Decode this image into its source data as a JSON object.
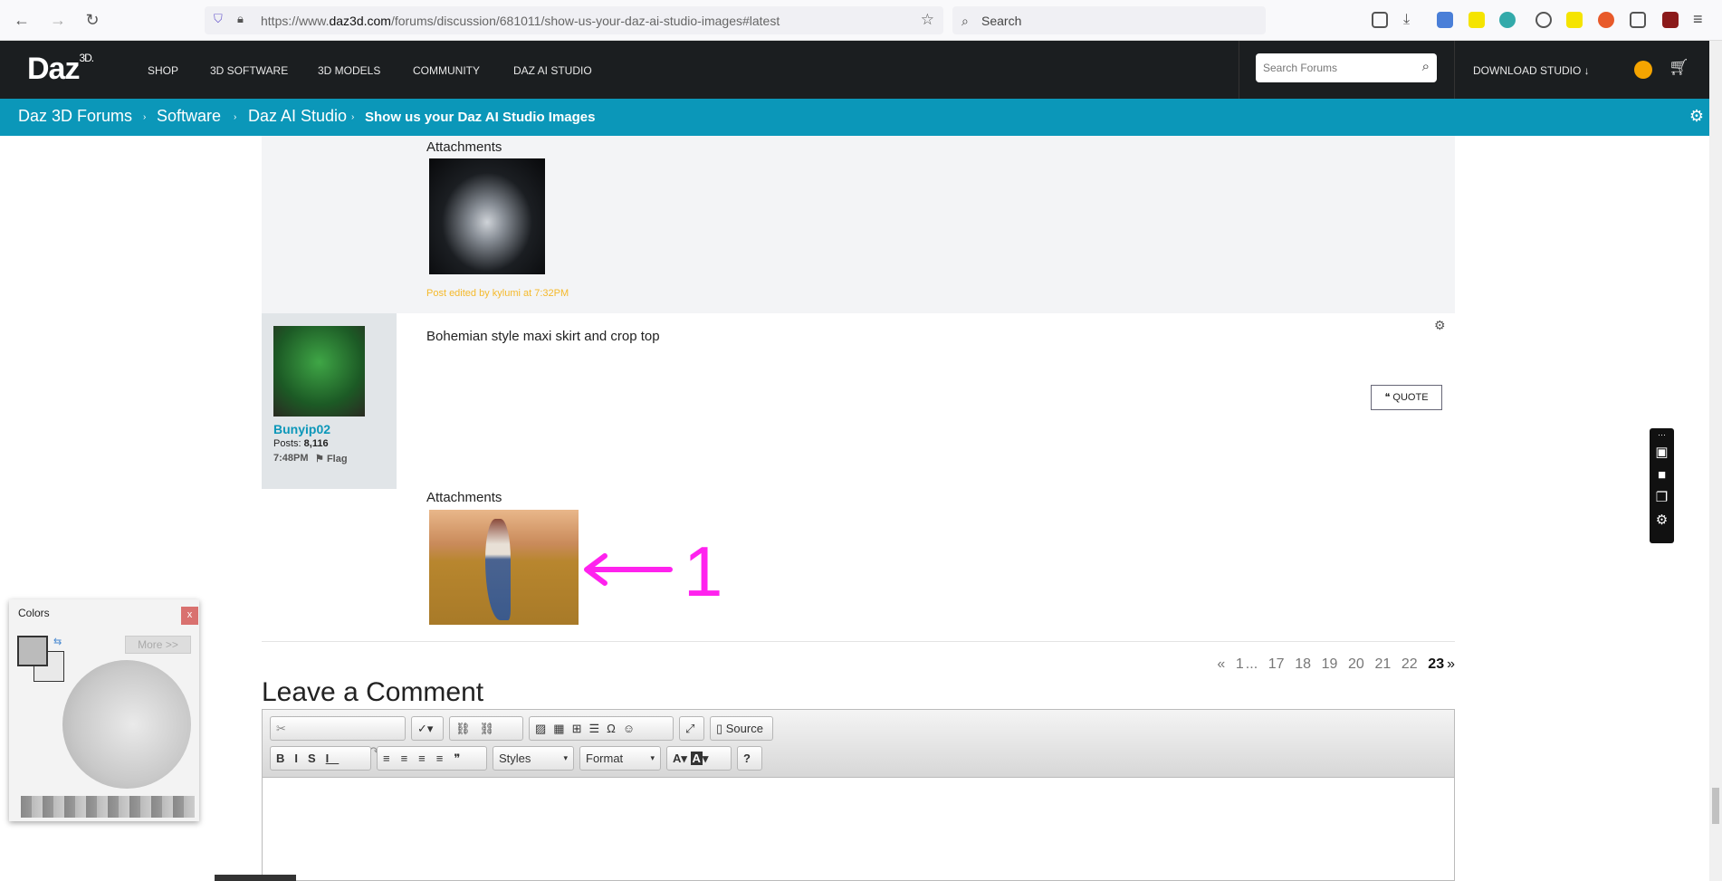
{
  "browser": {
    "url_prefix": "https://www.",
    "url_domain": "daz3d.com",
    "url_path": "/forums/discussion/681011/show-us-your-daz-ai-studio-images#latest",
    "search_placeholder": "Search"
  },
  "nav": {
    "logo": "Daz",
    "logo_sup": "3D.",
    "items": [
      "SHOP",
      "3D SOFTWARE",
      "3D MODELS",
      "COMMUNITY",
      "DAZ AI STUDIO"
    ],
    "search_placeholder": "Search Forums",
    "download": "DOWNLOAD STUDIO"
  },
  "breadcrumb": {
    "items": [
      "Daz 3D Forums",
      "Software",
      "Daz AI Studio"
    ],
    "current": "Show us your Daz AI Studio Images"
  },
  "post1": {
    "attachments_label": "Attachments",
    "edited": "Post edited by kylumi at 7:32PM"
  },
  "post2": {
    "username": "Bunyip02",
    "posts_label": "Posts:",
    "posts": "8,116",
    "time": "7:48PM",
    "flag": "Flag",
    "body": "Bohemian style maxi skirt and crop top",
    "quote": "QUOTE",
    "attachments_label": "Attachments",
    "annotation": "1"
  },
  "pagination": {
    "prev": "«",
    "pages": [
      "1",
      "...",
      "17",
      "18",
      "19",
      "20",
      "21",
      "22"
    ],
    "current": "23",
    "next": "»"
  },
  "comment": {
    "title": "Leave a Comment",
    "source": "Source",
    "styles": "Styles",
    "format": "Format"
  },
  "colors_panel": {
    "title": "Colors",
    "close": "x",
    "more": "More >>"
  },
  "colors": {
    "accent": "#0b97b9",
    "nav_bg": "#1b1e20",
    "annotation": "#ff22ee",
    "edited": "#f5b92a"
  }
}
